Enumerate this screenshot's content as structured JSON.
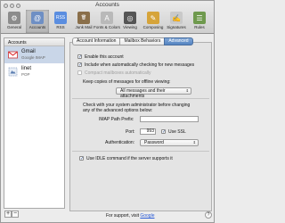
{
  "window": {
    "title": "Accounts"
  },
  "toolbar": [
    {
      "name": "toolbar-general",
      "icon": "switch-icon",
      "label": "General",
      "bg": "#8c8c8c",
      "glyph": "⚙",
      "active": false
    },
    {
      "name": "toolbar-accounts",
      "icon": "at-sign-icon",
      "label": "Accounts",
      "bg": "#6e8fc4",
      "glyph": "@",
      "active": true
    },
    {
      "name": "toolbar-rss",
      "icon": "rss-icon",
      "label": "RSS",
      "bg": "#5b8ee0",
      "glyph": "RSS",
      "active": false
    },
    {
      "name": "toolbar-junk-mail",
      "icon": "trash-icon",
      "label": "Junk Mail",
      "bg": "#8a6f4a",
      "glyph": "🗑",
      "active": false
    },
    {
      "name": "toolbar-fonts-colors",
      "icon": "fonts-icon",
      "label": "Fonts & Colors",
      "bg": "#b9b9b9",
      "glyph": "A",
      "active": false
    },
    {
      "name": "toolbar-viewing",
      "icon": "glasses-icon",
      "label": "Viewing",
      "bg": "#555555",
      "glyph": "◎",
      "active": false
    },
    {
      "name": "toolbar-composing",
      "icon": "pencil-icon",
      "label": "Composing",
      "bg": "#d6a43a",
      "glyph": "✎",
      "active": false
    },
    {
      "name": "toolbar-signatures",
      "icon": "signature-icon",
      "label": "Signatures",
      "bg": "#c9c9c9",
      "glyph": "✍",
      "active": false
    },
    {
      "name": "toolbar-rules",
      "icon": "rules-icon",
      "label": "Rules",
      "bg": "#6f9a4e",
      "glyph": "☰",
      "active": false
    }
  ],
  "sidebar": {
    "header": "Accounts",
    "accounts": [
      {
        "name": "Gmail",
        "type": "Google IMAP",
        "icon": "gmail-icon",
        "selected": true
      },
      {
        "name": "linet",
        "type": "POP",
        "icon": "stamp-icon",
        "selected": false
      }
    ],
    "add_label": "+",
    "remove_label": "−"
  },
  "tabs": [
    {
      "label": "Account Information",
      "active": false
    },
    {
      "label": "Mailbox Behaviors",
      "active": false
    },
    {
      "label": "Advanced",
      "active": true
    }
  ],
  "advanced": {
    "enable_account": {
      "label": "Enable this account",
      "checked": true
    },
    "auto_check": {
      "label": "Include when automatically checking for new messages",
      "checked": true
    },
    "compact": {
      "label": "Compact mailboxes automatically",
      "checked": false,
      "disabled": true
    },
    "offline_label": "Keep copies of messages for offline viewing:",
    "offline_value": "All messages and their attachments",
    "admin_note_1": "Check with your system administrator before changing",
    "admin_note_2": "any of the advanced options below:",
    "imap_prefix_label": "IMAP Path Prefix:",
    "imap_prefix_value": "",
    "port_label": "Port:",
    "port_value": "993",
    "ssl": {
      "label": "Use SSL",
      "checked": true
    },
    "auth_label": "Authentication:",
    "auth_value": "Password",
    "idle": {
      "label": "Use IDLE command if the server supports it",
      "checked": true
    }
  },
  "footer": {
    "support_prefix": "For support, visit",
    "support_link": "Google",
    "help_label": "?"
  }
}
